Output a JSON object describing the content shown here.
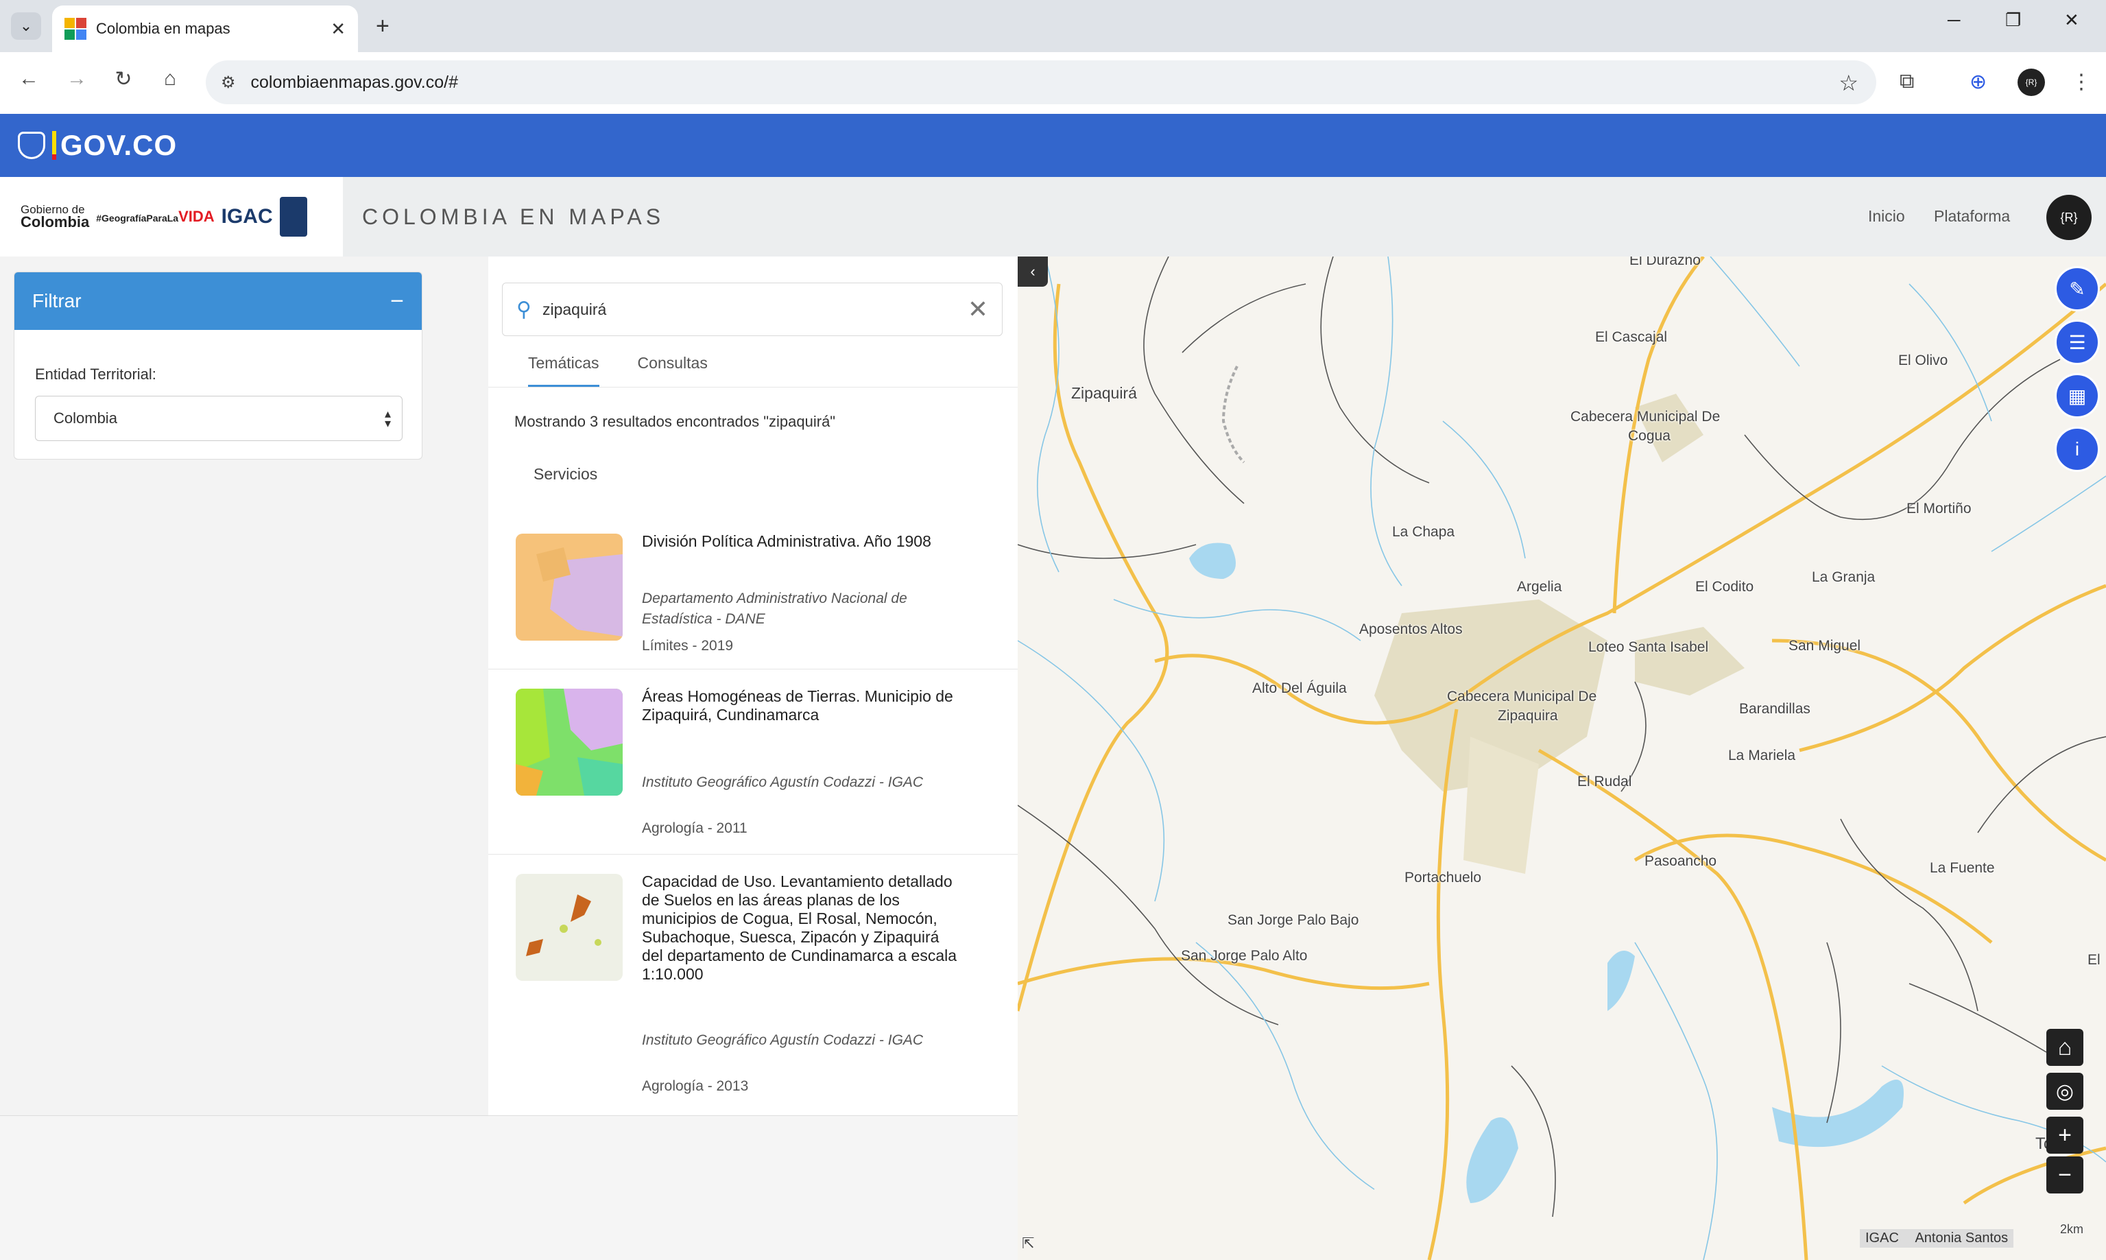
{
  "browser": {
    "tab_title": "Colombia en mapas",
    "new_tab": "+",
    "url": "colombiaenmapas.gov.co/#",
    "profile_initial": "{R}"
  },
  "gov_bar": {
    "brand": "GOV.CO"
  },
  "header": {
    "logo_gobierno": "Gobierno de",
    "logo_colombia": "Colombia",
    "logo_geografia": "#GeografíaParaLa",
    "logo_vida": "VIDA",
    "logo_igac": "IGAC",
    "app_title": "COLOMBIA EN MAPAS",
    "nav": [
      "Inicio",
      "Plataforma"
    ],
    "avatar": "{R}"
  },
  "filter": {
    "title": "Filtrar",
    "collapse_symbol": "−",
    "entity_label": "Entidad Territorial:",
    "entity_value": "Colombia"
  },
  "search": {
    "query": "zipaquirá",
    "tabs": [
      "Temáticas",
      "Consultas"
    ],
    "count_text": "Mostrando 3 resultados encontrados \"zipaquirá\"",
    "section": "Servicios",
    "results": [
      {
        "title": "División Política Administrativa. Año 1908",
        "org": "Departamento Administrativo Nacional de Estadística - DANE",
        "meta": "Límites  - 2019"
      },
      {
        "title": "Áreas Homogéneas de Tierras. Municipio de Zipaquirá, Cundinamarca",
        "org": "Instituto Geográfico Agustín Codazzi - IGAC",
        "meta": "Agrología   - 2011"
      },
      {
        "title": "Capacidad de Uso. Levantamiento detallado de Suelos en las áreas planas de los municipios de Cogua, El Rosal, Nemocón, Subachoque, Suesca, Zipacón y Zipaquirá del departamento de Cundinamarca a escala 1:10.000",
        "org": "Instituto Geográfico Agustín Codazzi - IGAC",
        "meta": "Agrología   - 2013"
      }
    ]
  },
  "map": {
    "labels": [
      "El Durazno",
      "Zipaquirá",
      "El Cascajal",
      "El Olivo",
      "Cabecera Municipal De",
      "Cogua",
      "El Mortiño",
      "La Chapa",
      "Argelia",
      "El Codito",
      "La Granja",
      "Aposentos Altos",
      "Loteo Santa Isabel",
      "San Miguel",
      "Alto Del Águila",
      "Cabecera Municipal De",
      "Zipaquira",
      "Barandillas",
      "La Mariela",
      "El Rudal",
      "Pasoancho",
      "La Fuente",
      "Portachuelo",
      "San Jorge Palo Bajo",
      "San Jorge Palo Alto",
      "Tocan",
      "El",
      "El"
    ],
    "attribution": "IGAC",
    "attribution_extra": "Antonia Santos",
    "scale": "2km",
    "collapse_symbol": "‹"
  },
  "colors": {
    "gov_blue": "#3366cc",
    "filter_blue": "#3d8fd6",
    "tool_blue": "#2d5be3",
    "road": "#f3c04a",
    "water": "#a8d8f0",
    "urban": "#e3ddc2"
  }
}
